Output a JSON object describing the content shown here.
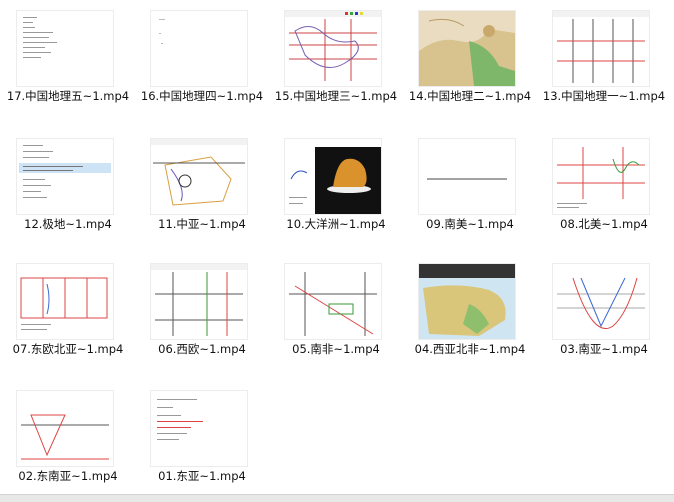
{
  "files": [
    {
      "name": "17.中国地理五~1.mp4",
      "thumb": "text-doc-icon"
    },
    {
      "name": "16.中国地理四~1.mp4",
      "thumb": "blank-doc-icon"
    },
    {
      "name": "15.中国地理三~1.mp4",
      "thumb": "map-lines-icon"
    },
    {
      "name": "14.中国地理二~1.mp4",
      "thumb": "china-map-icon"
    },
    {
      "name": "13.中国地理一~1.mp4",
      "thumb": "grid-lines-icon"
    },
    {
      "name": "12.极地~1.mp4",
      "thumb": "text-highlight-icon"
    },
    {
      "name": "11.中亚~1.mp4",
      "thumb": "sketch-map-icon"
    },
    {
      "name": "10.大洋洲~1.mp4",
      "thumb": "uluru-photo-icon"
    },
    {
      "name": "09.南美~1.mp4",
      "thumb": "single-line-icon"
    },
    {
      "name": "08.北美~1.mp4",
      "thumb": "red-grid-icon"
    },
    {
      "name": "07.东欧北亚~1.mp4",
      "thumb": "red-box-icon"
    },
    {
      "name": "06.西欧~1.mp4",
      "thumb": "grid-lines-icon"
    },
    {
      "name": "05.南非~1.mp4",
      "thumb": "diagonal-lines-icon"
    },
    {
      "name": "04.西亚北非~1.mp4",
      "thumb": "africa-map-icon"
    },
    {
      "name": "03.南亚~1.mp4",
      "thumb": "v-curve-icon"
    },
    {
      "name": "02.东南亚~1.mp4",
      "thumb": "triangle-icon"
    },
    {
      "name": "01.东亚~1.mp4",
      "thumb": "text-red-icon"
    }
  ]
}
